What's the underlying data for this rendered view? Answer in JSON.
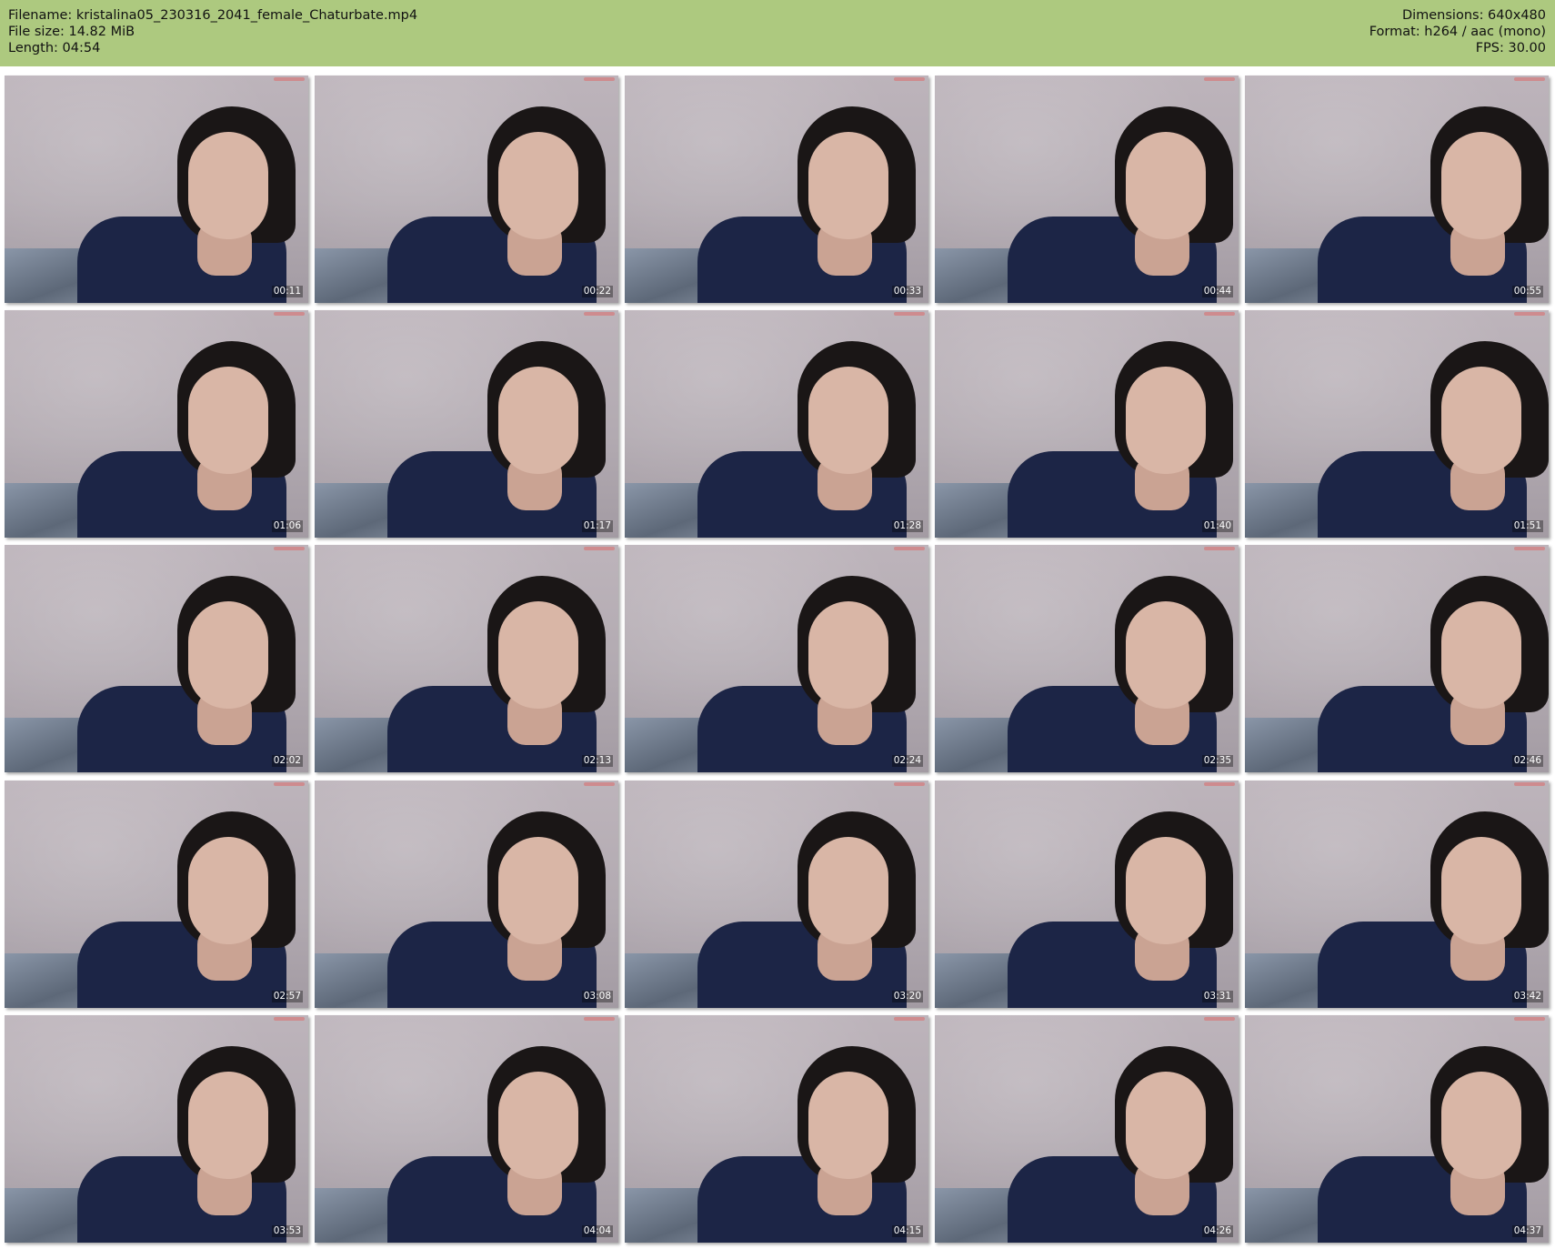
{
  "header": {
    "filename": "Filename: kristalina05_230316_2041_female_Chaturbate.mp4",
    "file_size": "File size: 14.82 MiB",
    "length": "Length: 04:54",
    "dimensions": "Dimensions: 640x480",
    "format": "Format: h264 / aac (mono)",
    "fps": "FPS: 30.00"
  },
  "colors": {
    "header_bg": "#adc97f",
    "page_bg": "#ffffff"
  },
  "thumbnails": [
    "00:11",
    "00:22",
    "00:33",
    "00:44",
    "00:55",
    "01:06",
    "01:17",
    "01:28",
    "01:40",
    "01:51",
    "02:02",
    "02:13",
    "02:24",
    "02:35",
    "02:46",
    "02:57",
    "03:08",
    "03:20",
    "03:31",
    "03:42",
    "03:53",
    "04:04",
    "04:15",
    "04:26",
    "04:37"
  ]
}
